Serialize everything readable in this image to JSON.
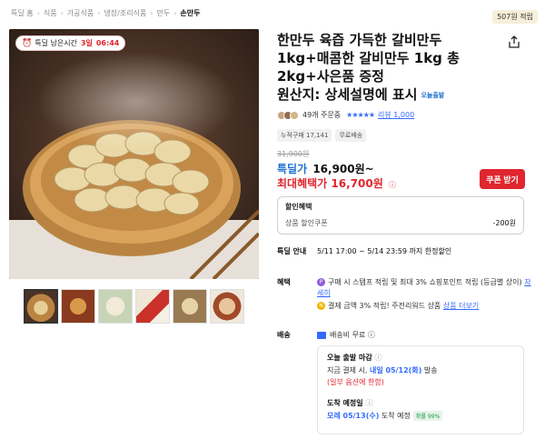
{
  "breadcrumb": [
    "특딜 홈",
    "식품",
    "가공식품",
    "냉장/조리식품",
    "만두",
    "손만두"
  ],
  "points_badge": "507원 적립",
  "timer": {
    "label": "특딜 남은시간",
    "days": "3일",
    "time": "06:44"
  },
  "title": {
    "line1": "한만두 육즙 가득한 갈비만두",
    "line2": "1kg+매콤한 갈비만두 1kg 총",
    "line3": "2kg+사은품 증정",
    "line4": "원산지: 상세설명에 표시",
    "today_badge": "오늘출발"
  },
  "rating": {
    "orders": "49개 주문중",
    "stars": "★★★★★",
    "reviews": "리뷰 1,000"
  },
  "tags": [
    "누적구매 17,141",
    "무료배송"
  ],
  "price": {
    "original": "31,900원",
    "sale_label": "특딜가",
    "sale_price": "16,900원~",
    "max_label": "최대혜택가",
    "max_price": "16,700원",
    "max_info": "ⓘ"
  },
  "coupon_button": "쿠폰 받기",
  "discount": {
    "header": "할인혜택",
    "name": "상품 할인쿠폰",
    "amount": "-200원"
  },
  "deal": {
    "header": "특딜 안내",
    "period": "5/11 17:00 ~ 5/14 23:59 까지 한정할인"
  },
  "benefits": {
    "label": "혜택",
    "b1_text": "구매 시 스탬프 적립 및 최대 3% 쇼핑포인트 적립 (등급별 상이)",
    "b1_link": "자세히",
    "b2_text": "결제 금액 3% 적립! 주전리워드 상품",
    "b2_link": "상품 더보기"
  },
  "shipping": {
    "label": "배송",
    "free": "배송비 무료 ⓘ",
    "depart_header": "오늘 출발 마감",
    "depart_pre": "지금 결제 시, ",
    "depart_date": "내일 05/12(화)",
    "depart_post": " 발송",
    "note": "(일부 옵션에 한함)",
    "arrive_header": "도착 예정일",
    "arrive_date": "모레 05/13(수)",
    "arrive_post": " 도착 예정",
    "arrive_pct": "확률 99%"
  },
  "colors": {
    "accent_blue": "#346aff",
    "red": "#e0262e",
    "title": "#111111"
  },
  "icons": [
    "share-icon",
    "clock-icon",
    "info-icon",
    "truck-icon"
  ]
}
